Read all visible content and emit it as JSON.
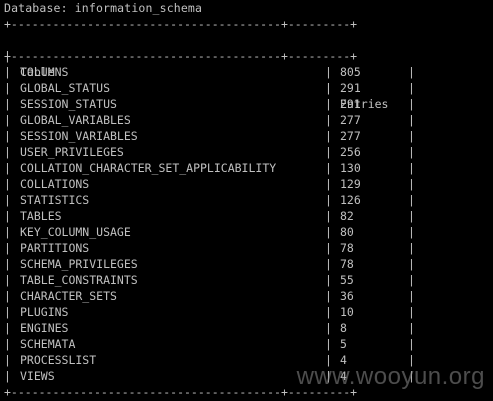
{
  "database_line": "Database: information_schema",
  "border_line": "+---------------------------------------+---------+",
  "columns": {
    "table_header": "Table",
    "entries_header": "Entries"
  },
  "pipe": "|",
  "rows": [
    {
      "table": "COLUMNS",
      "entries": "805"
    },
    {
      "table": "GLOBAL_STATUS",
      "entries": "291"
    },
    {
      "table": "SESSION_STATUS",
      "entries": "291"
    },
    {
      "table": "GLOBAL_VARIABLES",
      "entries": "277"
    },
    {
      "table": "SESSION_VARIABLES",
      "entries": "277"
    },
    {
      "table": "USER_PRIVILEGES",
      "entries": "256"
    },
    {
      "table": "COLLATION_CHARACTER_SET_APPLICABILITY",
      "entries": "130"
    },
    {
      "table": "COLLATIONS",
      "entries": "129"
    },
    {
      "table": "STATISTICS",
      "entries": "126"
    },
    {
      "table": "TABLES",
      "entries": "82"
    },
    {
      "table": "KEY_COLUMN_USAGE",
      "entries": "80"
    },
    {
      "table": "PARTITIONS",
      "entries": "78"
    },
    {
      "table": "SCHEMA_PRIVILEGES",
      "entries": "78"
    },
    {
      "table": "TABLE_CONSTRAINTS",
      "entries": "55"
    },
    {
      "table": "CHARACTER_SETS",
      "entries": "36"
    },
    {
      "table": "PLUGINS",
      "entries": "10"
    },
    {
      "table": "ENGINES",
      "entries": "8"
    },
    {
      "table": "SCHEMATA",
      "entries": "5"
    },
    {
      "table": "PROCESSLIST",
      "entries": "4"
    },
    {
      "table": "VIEWS",
      "entries": "4"
    }
  ],
  "watermark": "www.wooyun.org",
  "colors": {
    "background": "#000000",
    "text": "#c0c0c0"
  }
}
